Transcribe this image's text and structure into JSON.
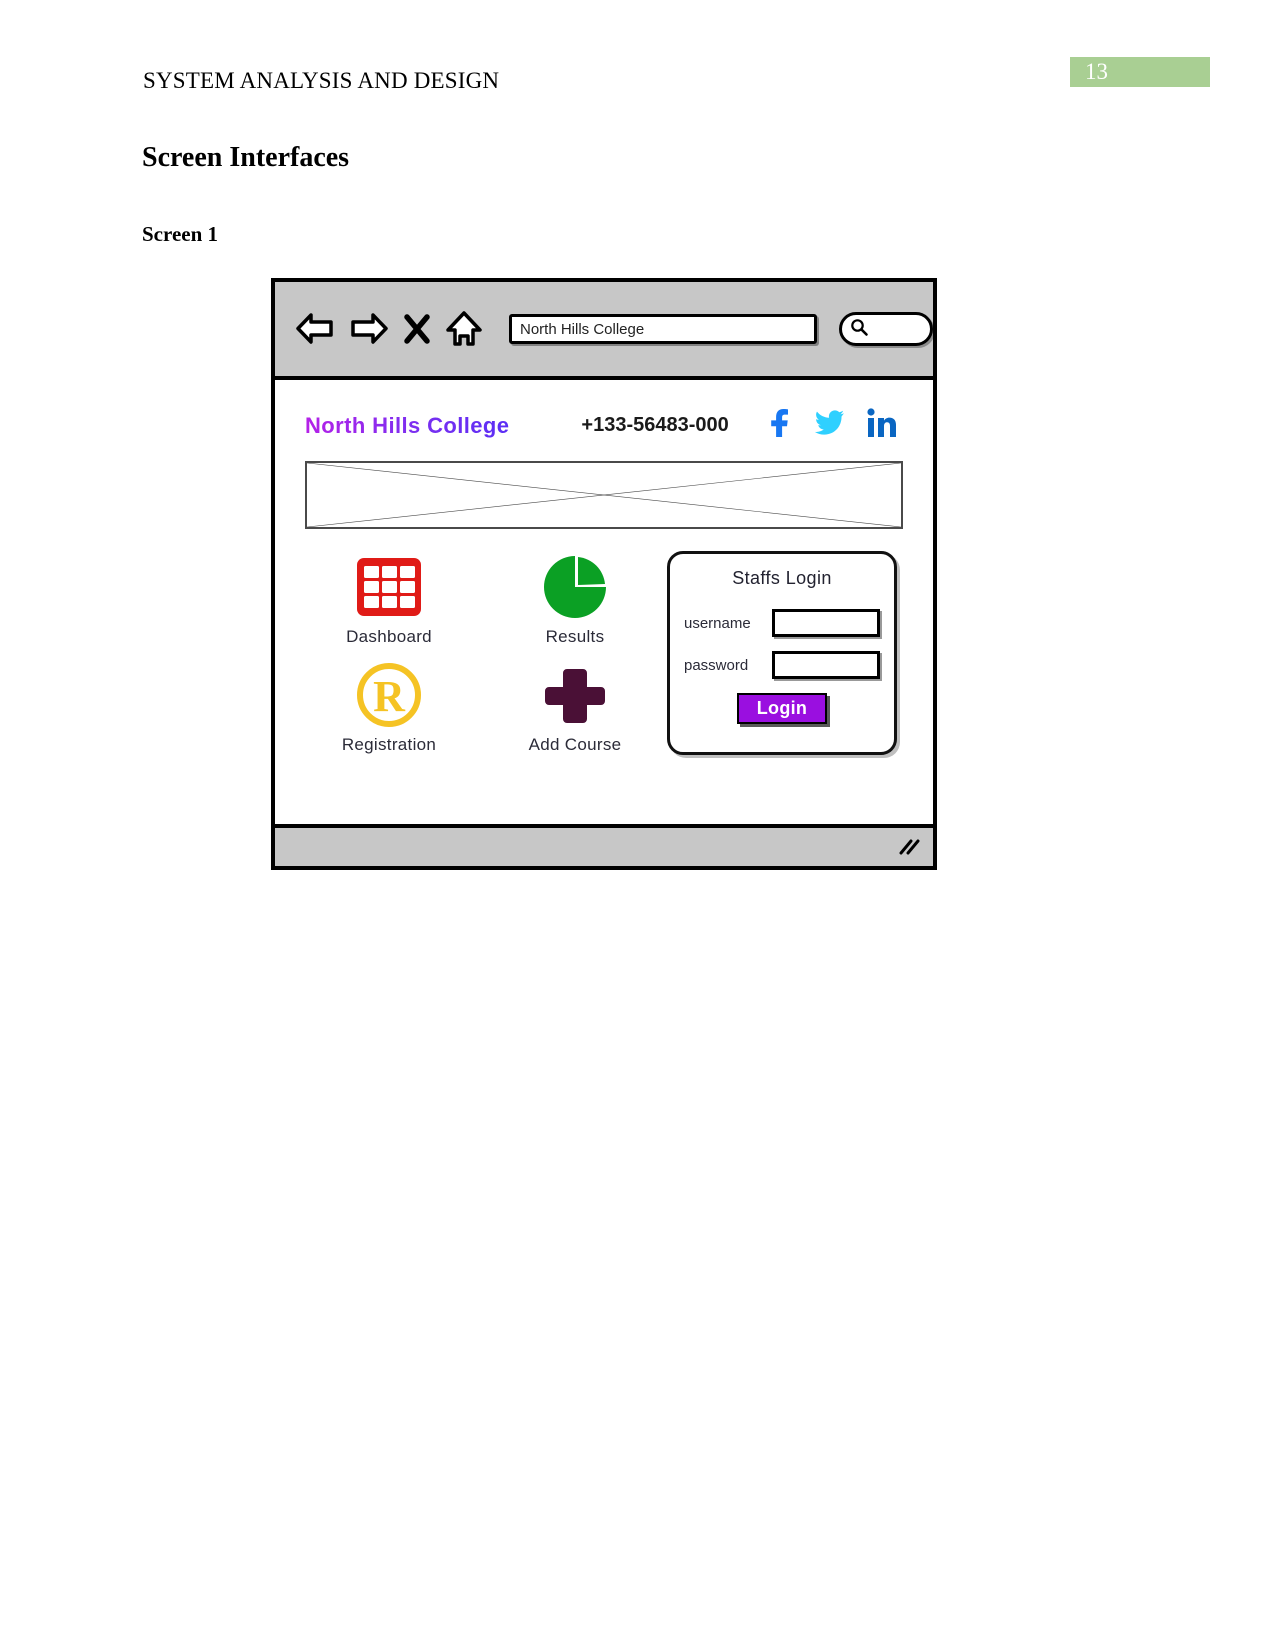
{
  "document": {
    "running_header": "SYSTEM ANALYSIS AND DESIGN",
    "page_number": "13",
    "page_number_bg": "#a9cf93",
    "section_title": "Screen Interfaces",
    "sub_title": "Screen 1"
  },
  "browser": {
    "nav": {
      "back_icon": "back-arrow-icon",
      "forward_icon": "forward-arrow-icon",
      "stop_icon": "close-x-icon",
      "home_icon": "home-icon"
    },
    "url_value": "North Hills College",
    "search_value": "",
    "search_icon": "magnifier-icon",
    "resize_grip_icon": "resize-grip-icon"
  },
  "site": {
    "brand": "North Hills College",
    "brand_color": "#a01ce6",
    "phone": "+133-56483-000",
    "social": [
      {
        "name": "facebook-icon",
        "color": "#1877f2"
      },
      {
        "name": "twitter-icon",
        "color": "#2fd0ff"
      },
      {
        "name": "linkedin-icon",
        "color": "#0a66c2"
      }
    ],
    "banner_placeholder": "image-placeholder-crossed-box",
    "tiles": [
      {
        "label": "Dashboard",
        "icon": "grid-table-icon",
        "color": "#e01b17"
      },
      {
        "label": "Results",
        "icon": "pie-chart-icon",
        "color": "#0ba024"
      },
      {
        "label": "Registration",
        "icon": "registered-r-icon",
        "color": "#f5c324"
      },
      {
        "label": "Add Course",
        "icon": "plus-icon",
        "color": "#4a1036"
      }
    ],
    "login": {
      "title": "Staffs Login",
      "username_label": "username",
      "username_value": "",
      "password_label": "password",
      "password_value": "",
      "button_label": "Login",
      "button_color": "#9a0fe0"
    }
  }
}
